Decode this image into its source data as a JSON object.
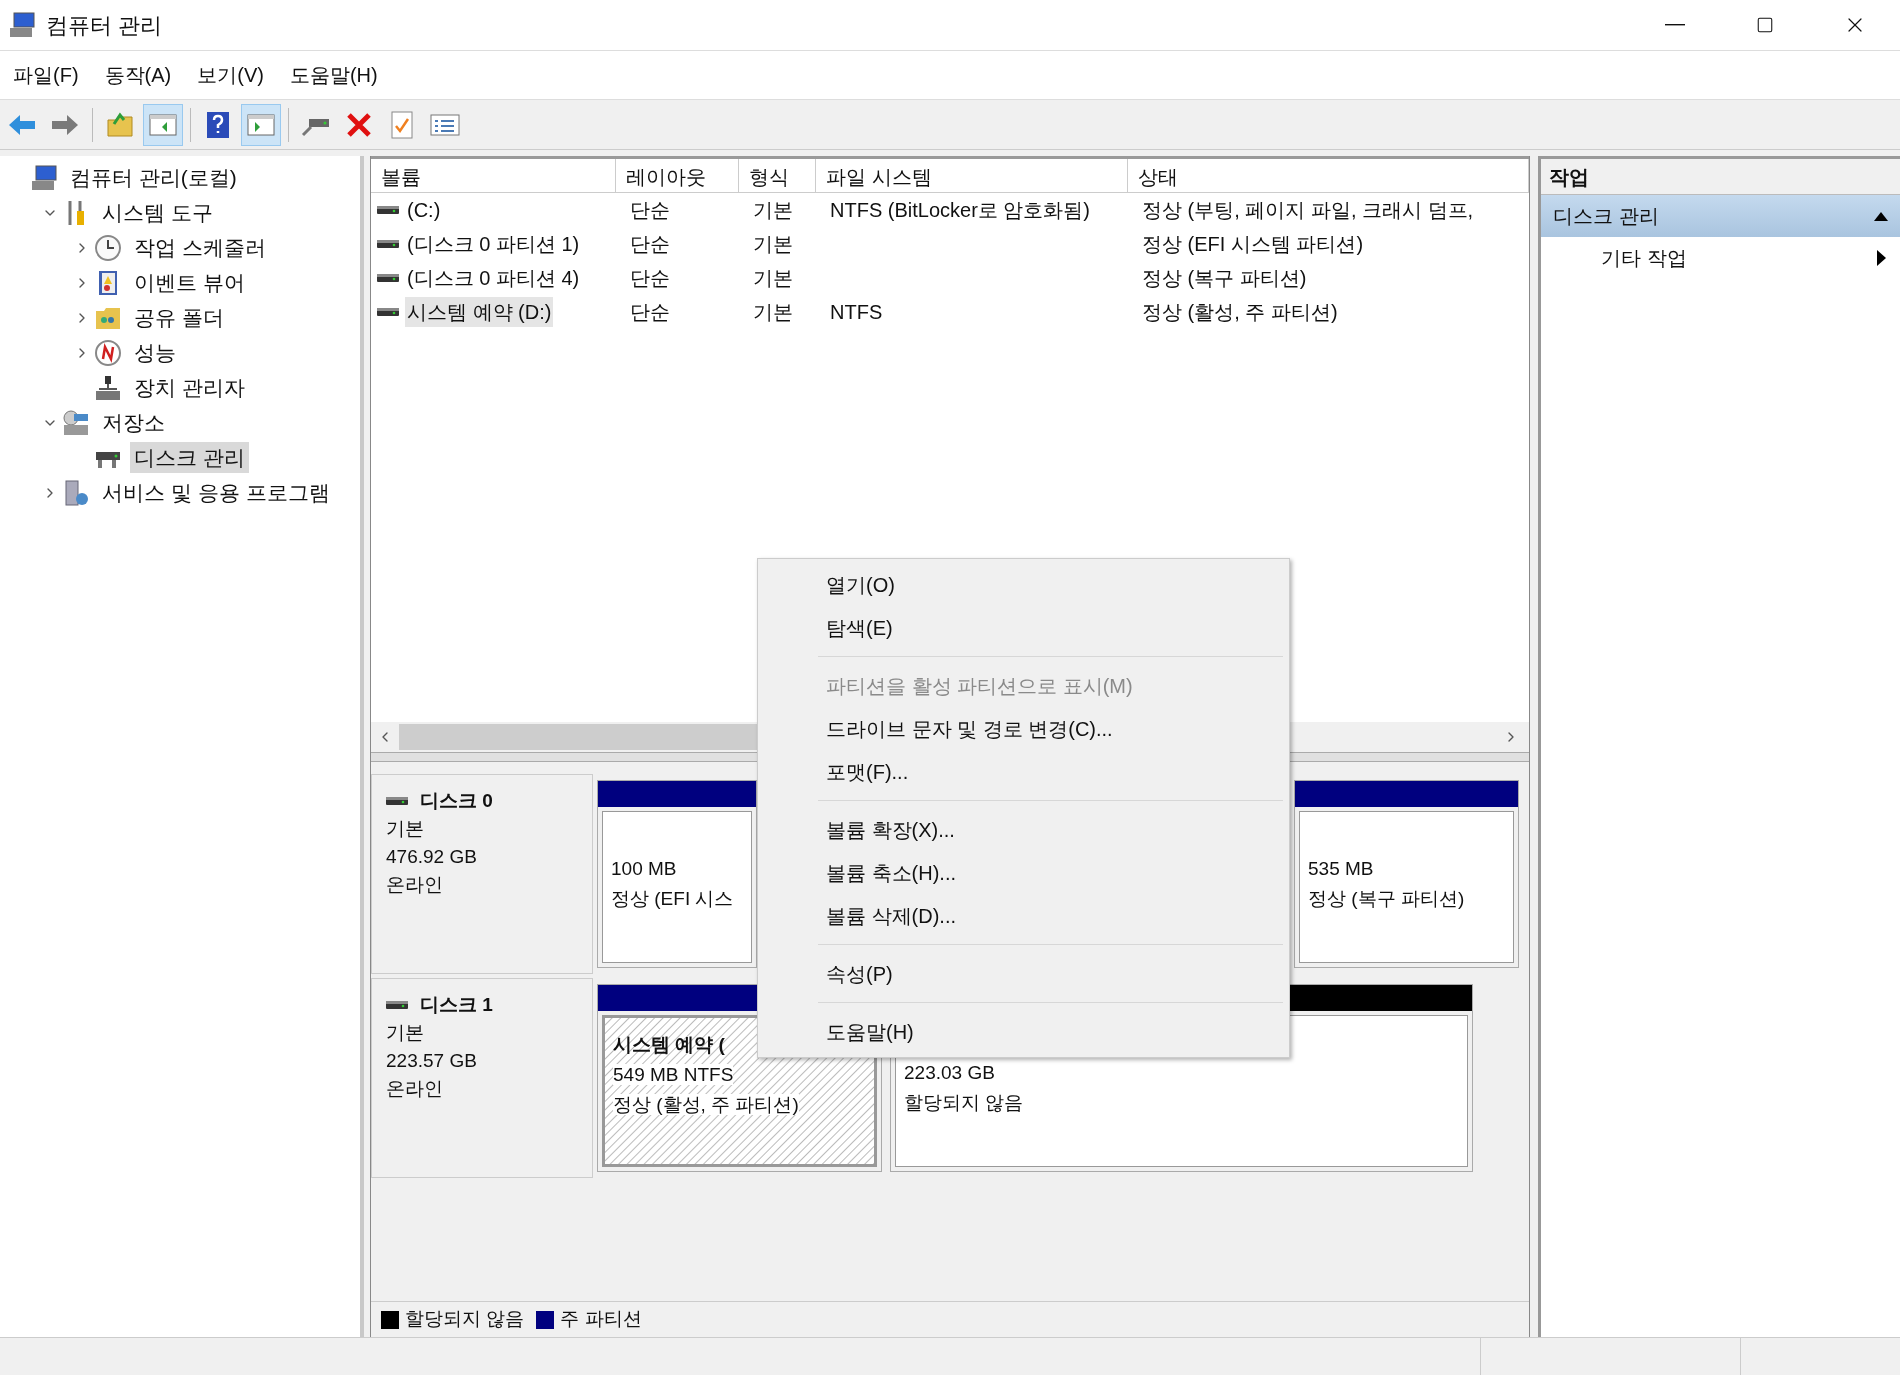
{
  "window": {
    "title": "컴퓨터 관리"
  },
  "menu_bar": [
    "파일(F)",
    "동작(A)",
    "보기(V)",
    "도움말(H)"
  ],
  "toolbar": [
    {
      "kind": "back",
      "pressed": false
    },
    {
      "kind": "forward",
      "pressed": false
    },
    {
      "kind": "separator"
    },
    {
      "kind": "up",
      "pressed": false
    },
    {
      "kind": "tree",
      "pressed": true
    },
    {
      "kind": "separator"
    },
    {
      "kind": "help",
      "pressed": false
    },
    {
      "kind": "pane",
      "pressed": true
    },
    {
      "kind": "separator"
    },
    {
      "kind": "drive",
      "pressed": false
    },
    {
      "kind": "delete",
      "pressed": false
    },
    {
      "kind": "check",
      "pressed": false
    },
    {
      "kind": "list",
      "pressed": false
    }
  ],
  "tree": [
    {
      "label": "컴퓨터 관리(로컬)",
      "selected": false,
      "children": [
        {
          "label": "시스템 도구",
          "expanded": true,
          "selected": false,
          "children": [
            {
              "label": "작업 스케줄러",
              "expanded": false,
              "selected": false
            },
            {
              "label": "이벤트 뷰어",
              "expanded": false,
              "selected": false
            },
            {
              "label": "공유 폴더",
              "expanded": false,
              "selected": false
            },
            {
              "label": "성능",
              "expanded": false,
              "selected": false
            },
            {
              "label": "장치 관리자",
              "selected": false
            }
          ]
        },
        {
          "label": "저장소",
          "expanded": true,
          "selected": false,
          "children": [
            {
              "label": "디스크 관리",
              "selected": true
            }
          ]
        },
        {
          "label": "서비스 및 응용 프로그램",
          "expanded": false,
          "selected": false
        }
      ]
    }
  ],
  "volumes": {
    "columns": [
      "볼륨",
      "레이아웃",
      "형식",
      "파일 시스템",
      "상태"
    ],
    "rows": [
      {
        "cells": [
          "(C:)",
          "단순",
          "기본",
          "NTFS (BitLocker로 암호화됨)",
          "정상 (부팅, 페이지 파일, 크래시 덤프,"
        ],
        "selected": false
      },
      {
        "cells": [
          "(디스크 0 파티션 1)",
          "단순",
          "기본",
          "",
          "정상 (EFI 시스템 파티션)"
        ],
        "selected": false
      },
      {
        "cells": [
          "(디스크 0 파티션 4)",
          "단순",
          "기본",
          "",
          "정상 (복구 파티션)"
        ],
        "selected": false
      },
      {
        "cells": [
          "시스템 예약 (D:)",
          "단순",
          "기본",
          "NTFS",
          "정상 (활성, 주 파티션)"
        ],
        "selected": true
      }
    ]
  },
  "disks": [
    {
      "name": "디스크 0",
      "type": "기본",
      "size": "476.92 GB",
      "status": "온라인",
      "partitions": [
        {
          "kind": "primary",
          "lines": [
            "100 MB",
            "정상 (EFI 시스"
          ],
          "selected": false
        },
        {
          "kind": "primary",
          "lines": [
            "535 MB",
            "정상 (복구 파티션)"
          ],
          "selected": false
        }
      ]
    },
    {
      "name": "디스크 1",
      "type": "기본",
      "size": "223.57 GB",
      "status": "온라인",
      "partitions": [
        {
          "kind": "primary",
          "title": "시스템 예약 (",
          "lines": [
            "549 MB NTFS",
            "정상 (활성, 주 파티션)"
          ],
          "selected": true
        },
        {
          "kind": "unallocated",
          "lines": [
            "223.03 GB",
            "할당되지 않음"
          ],
          "selected": false
        }
      ]
    }
  ],
  "legend": [
    {
      "label": "할당되지 않음",
      "color": "#000000"
    },
    {
      "label": "주 파티션",
      "color": "#00007f"
    }
  ],
  "actions": {
    "title": "작업",
    "section": {
      "label": "디스크 관리",
      "expanded": true
    },
    "items": [
      {
        "label": "기타 작업"
      }
    ]
  },
  "context_menu": [
    {
      "kind": "item",
      "label": "열기(O)",
      "disabled": false
    },
    {
      "kind": "item",
      "label": "탐색(E)",
      "disabled": false
    },
    {
      "kind": "separator"
    },
    {
      "kind": "item",
      "label": "파티션을 활성 파티션으로 표시(M)",
      "disabled": true
    },
    {
      "kind": "item",
      "label": "드라이브 문자 및 경로 변경(C)...",
      "disabled": false
    },
    {
      "kind": "item",
      "label": "포맷(F)...",
      "disabled": false
    },
    {
      "kind": "separator"
    },
    {
      "kind": "item",
      "label": "볼륨 확장(X)...",
      "disabled": false
    },
    {
      "kind": "item",
      "label": "볼륨 축소(H)...",
      "disabled": false
    },
    {
      "kind": "item",
      "label": "볼륨 삭제(D)...",
      "disabled": false
    },
    {
      "kind": "separator"
    },
    {
      "kind": "item",
      "label": "속성(P)",
      "disabled": false
    },
    {
      "kind": "separator"
    },
    {
      "kind": "item",
      "label": "도움말(H)",
      "disabled": false
    }
  ]
}
